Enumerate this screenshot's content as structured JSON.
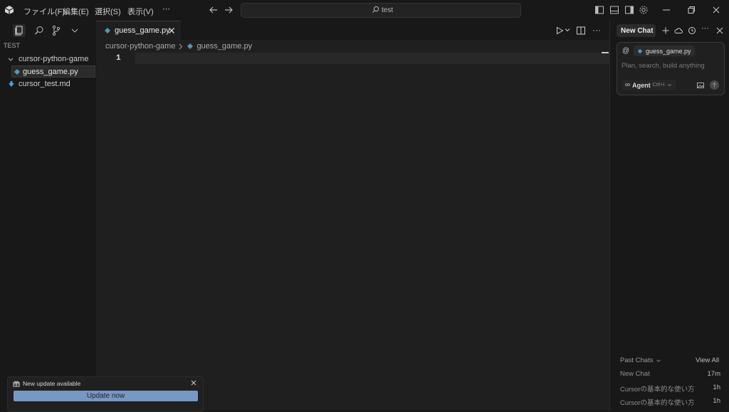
{
  "titlebar": {
    "menus": [
      "ファイル(F)",
      "編集(E)",
      "選択(S)",
      "表示(V)",
      "⋯"
    ],
    "search_text": "test"
  },
  "sidebar": {
    "section_title": "TEST",
    "items": [
      {
        "label": "cursor-python-game",
        "type": "folder",
        "expanded": true
      },
      {
        "label": "guess_game.py",
        "type": "python-file",
        "selected": true
      },
      {
        "label": "cursor_test.md",
        "type": "markdown-file"
      }
    ]
  },
  "editor": {
    "tab_label": "guess_game.py",
    "breadcrumb": [
      "cursor-python-game",
      "guess_game.py"
    ],
    "line_number": "1"
  },
  "chat": {
    "tab_label": "New Chat",
    "context_prefix": "@",
    "context_file": "guess_game.py",
    "placeholder": "Plan, search, build anything",
    "mode_label": "Agent",
    "mode_shortcut": "Ctrl+I",
    "past_chats_label": "Past Chats",
    "view_all_label": "View All",
    "history": [
      {
        "title": "New Chat",
        "time": "17m"
      },
      {
        "title": "Cursorの基本的な使い方",
        "time": "1h"
      },
      {
        "title": "Cursorの基本的な使い方",
        "time": "1h"
      }
    ]
  },
  "notification": {
    "message": "New update available",
    "button_label": "Update now"
  },
  "colors": {
    "accent": "#7797c5",
    "python_icon": "#519aba",
    "markdown_icon": "#42a5f5"
  }
}
